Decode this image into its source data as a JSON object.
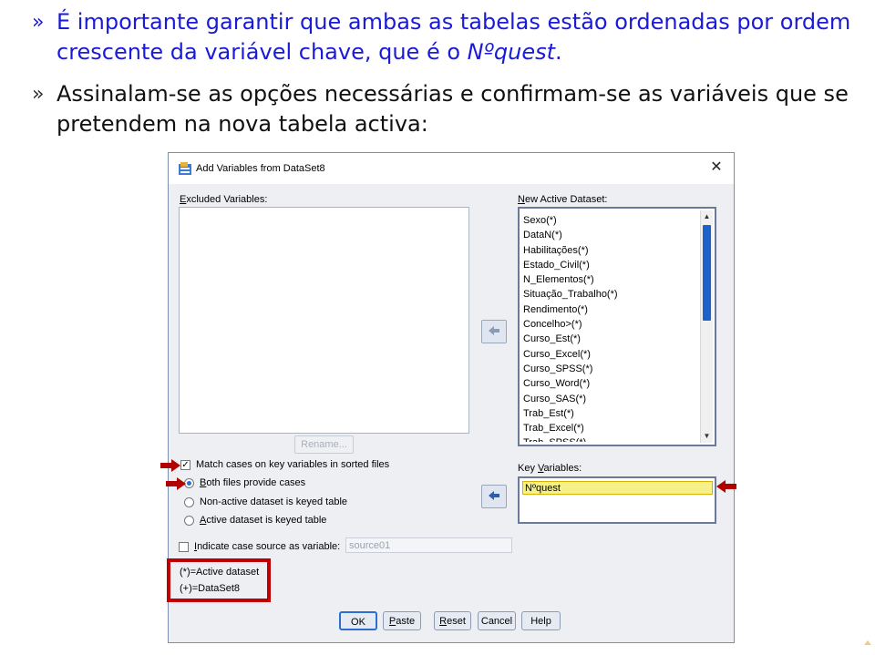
{
  "slide": {
    "bullets": [
      {
        "mark": "»",
        "line1": "É importante garantir que ambas as tabelas estão ordenadas por ordem",
        "line2_prefix": "crescente da variável chave, que é o ",
        "line2_emph": "Nºquest",
        "line2_suffix": "."
      },
      {
        "mark": "»",
        "line1": "Assinalam-se as opções necessárias e confirmam-se as variáveis que se",
        "line2": "pretendem na nova tabela activa:"
      }
    ]
  },
  "dialog": {
    "title": "Add Variables from DataSet8",
    "close": "✕",
    "excluded_label": {
      "u": "E",
      "rest": "xcluded Variables:"
    },
    "rename_label": "Rename...",
    "new_active_label": {
      "pre": "",
      "u": "N",
      "rest": "ew Active Dataset:"
    },
    "new_active_items": [
      "Sexo(*)",
      "DataN(*)",
      "Habilitações(*)",
      "Estado_Civil(*)",
      "N_Elementos(*)",
      "Situação_Trabalho(*)",
      "Rendimento(*)",
      "Concelho>(*)",
      "Curso_Est(*)",
      "Curso_Excel(*)",
      "Curso_SPSS(*)",
      "Curso_Word(*)",
      "Curso_SAS(*)",
      "Trab_Est(*)",
      "Trab_Excel(*)",
      "Trab_SPSS(*)"
    ],
    "key_label": {
      "pre": "Key ",
      "u": "V",
      "rest": "ariables:"
    },
    "key_items": [
      "Nºquest"
    ],
    "match_cases": {
      "label": "Match cases on key variables in sorted files",
      "checked": true
    },
    "radios": [
      {
        "u": "B",
        "rest": "oth files provide cases",
        "selected": true
      },
      {
        "u": "",
        "rest": "Non-active dataset is keyed table",
        "selected": false
      },
      {
        "u": "A",
        "rest": "ctive dataset is keyed table",
        "selected": false
      }
    ],
    "indicate_source": {
      "u": "I",
      "rest": "ndicate case source as variable:",
      "checked": false,
      "value": "source01"
    },
    "legend": [
      "(*)=Active dataset",
      "(+)=DataSet8"
    ],
    "buttons": {
      "ok": "OK",
      "paste": "Paste",
      "reset": "Reset",
      "cancel": "Cancel",
      "help": "Help"
    }
  },
  "colors": {
    "accent_red": "#c00000",
    "blue_text": "#1a1ad8",
    "highlight": "#f5f08a"
  }
}
